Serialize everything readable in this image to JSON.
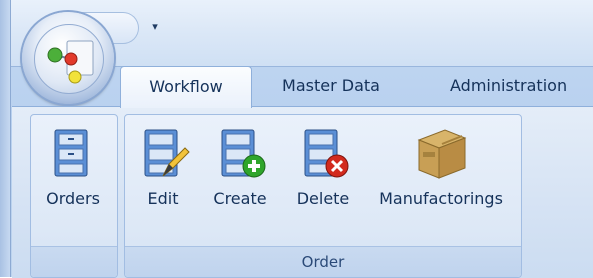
{
  "tabs": [
    "Workflow",
    "Master Data",
    "Administration"
  ],
  "groups": {
    "orders": {
      "buttons": [
        "Orders"
      ]
    },
    "order": {
      "label": "Order",
      "buttons": [
        "Edit",
        "Create",
        "Delete",
        "Manufactorings"
      ]
    }
  },
  "icons": {
    "app_orb": "app-orb-icon",
    "qat_dropdown": "▾",
    "orders": "file-cabinet-icon",
    "edit": "file-cabinet-pencil-icon",
    "create": "file-cabinet-plus-icon",
    "delete": "file-cabinet-x-icon",
    "manufactorings": "cardboard-box-icon"
  },
  "colors": {
    "accent": "#1f4f8f",
    "plus": "#2fa52c",
    "delete": "#d22a1e"
  }
}
